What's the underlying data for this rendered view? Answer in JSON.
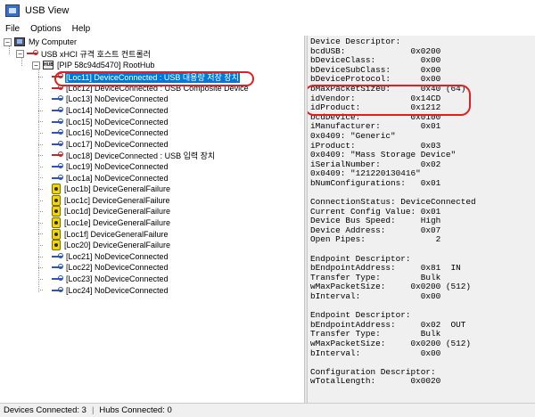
{
  "window": {
    "title": "USB View"
  },
  "menu": [
    "File",
    "Options",
    "Help"
  ],
  "tree": {
    "root": "My Computer",
    "controller": "USB xHCI 규격 호스트 컨트롤러",
    "hub": "[PIP 58c94d5470] RootHub",
    "ports": [
      {
        "label": "[Loc11] DeviceConnected : USB 대용량 저장 장치",
        "icon": "usb-red",
        "selected": true
      },
      {
        "label": "[Loc12] DeviceConnected : USB Composite Device",
        "icon": "usb-red",
        "selected": false
      },
      {
        "label": "[Loc13] NoDeviceConnected",
        "icon": "usb",
        "selected": false
      },
      {
        "label": "[Loc14] NoDeviceConnected",
        "icon": "usb",
        "selected": false
      },
      {
        "label": "[Loc15] NoDeviceConnected",
        "icon": "usb",
        "selected": false
      },
      {
        "label": "[Loc16] NoDeviceConnected",
        "icon": "usb",
        "selected": false
      },
      {
        "label": "[Loc17] NoDeviceConnected",
        "icon": "usb",
        "selected": false
      },
      {
        "label": "[Loc18] DeviceConnected : USB 입력 장치",
        "icon": "usb-red",
        "selected": false
      },
      {
        "label": "[Loc19] NoDeviceConnected",
        "icon": "usb",
        "selected": false
      },
      {
        "label": "[Loc1a] NoDeviceConnected",
        "icon": "usb",
        "selected": false
      },
      {
        "label": "[Loc1b] DeviceGeneralFailure",
        "icon": "fail",
        "selected": false
      },
      {
        "label": "[Loc1c] DeviceGeneralFailure",
        "icon": "fail",
        "selected": false
      },
      {
        "label": "[Loc1d] DeviceGeneralFailure",
        "icon": "fail",
        "selected": false
      },
      {
        "label": "[Loc1e] DeviceGeneralFailure",
        "icon": "fail",
        "selected": false
      },
      {
        "label": "[Loc1f] DeviceGeneralFailure",
        "icon": "fail",
        "selected": false
      },
      {
        "label": "[Loc20] DeviceGeneralFailure",
        "icon": "fail",
        "selected": false
      },
      {
        "label": "[Loc21] NoDeviceConnected",
        "icon": "usb",
        "selected": false
      },
      {
        "label": "[Loc22] NoDeviceConnected",
        "icon": "usb",
        "selected": false
      },
      {
        "label": "[Loc23] NoDeviceConnected",
        "icon": "usb",
        "selected": false
      },
      {
        "label": "[Loc24] NoDeviceConnected",
        "icon": "usb",
        "selected": false
      }
    ]
  },
  "details": [
    "Device Descriptor:",
    "bcdUSB:             0x0200",
    "bDeviceClass:         0x00",
    "bDeviceSubClass:      0x00",
    "bDeviceProtocol:      0x00",
    "bMaxPacketSize0:      0x40 (64)",
    "idVendor:           0x14CD",
    "idProduct:          0x1212",
    "bcdDevice:          0x0100",
    "iManufacturer:        0x01",
    "0x0409: \"Generic\"",
    "iProduct:             0x03",
    "0x0409: \"Mass Storage Device\"",
    "iSerialNumber:        0x02",
    "0x0409: \"121220130416\"",
    "bNumConfigurations:   0x01",
    "",
    "ConnectionStatus: DeviceConnected",
    "Current Config Value: 0x01",
    "Device Bus Speed:     High",
    "Device Address:       0x07",
    "Open Pipes:              2",
    "",
    "Endpoint Descriptor:",
    "bEndpointAddress:     0x81  IN",
    "Transfer Type:        Bulk",
    "wMaxPacketSize:     0x0200 (512)",
    "bInterval:            0x00",
    "",
    "Endpoint Descriptor:",
    "bEndpointAddress:     0x02  OUT",
    "Transfer Type:        Bulk",
    "wMaxPacketSize:     0x0200 (512)",
    "bInterval:            0x00",
    "",
    "Configuration Descriptor:",
    "wTotalLength:       0x0020"
  ],
  "status": {
    "devices": "Devices Connected: 3",
    "hubs": "Hubs Connected: 0"
  },
  "colors": {
    "selection": "#0078d7",
    "annotation": "#e02020",
    "detail_bg": "#f0f0f0"
  }
}
